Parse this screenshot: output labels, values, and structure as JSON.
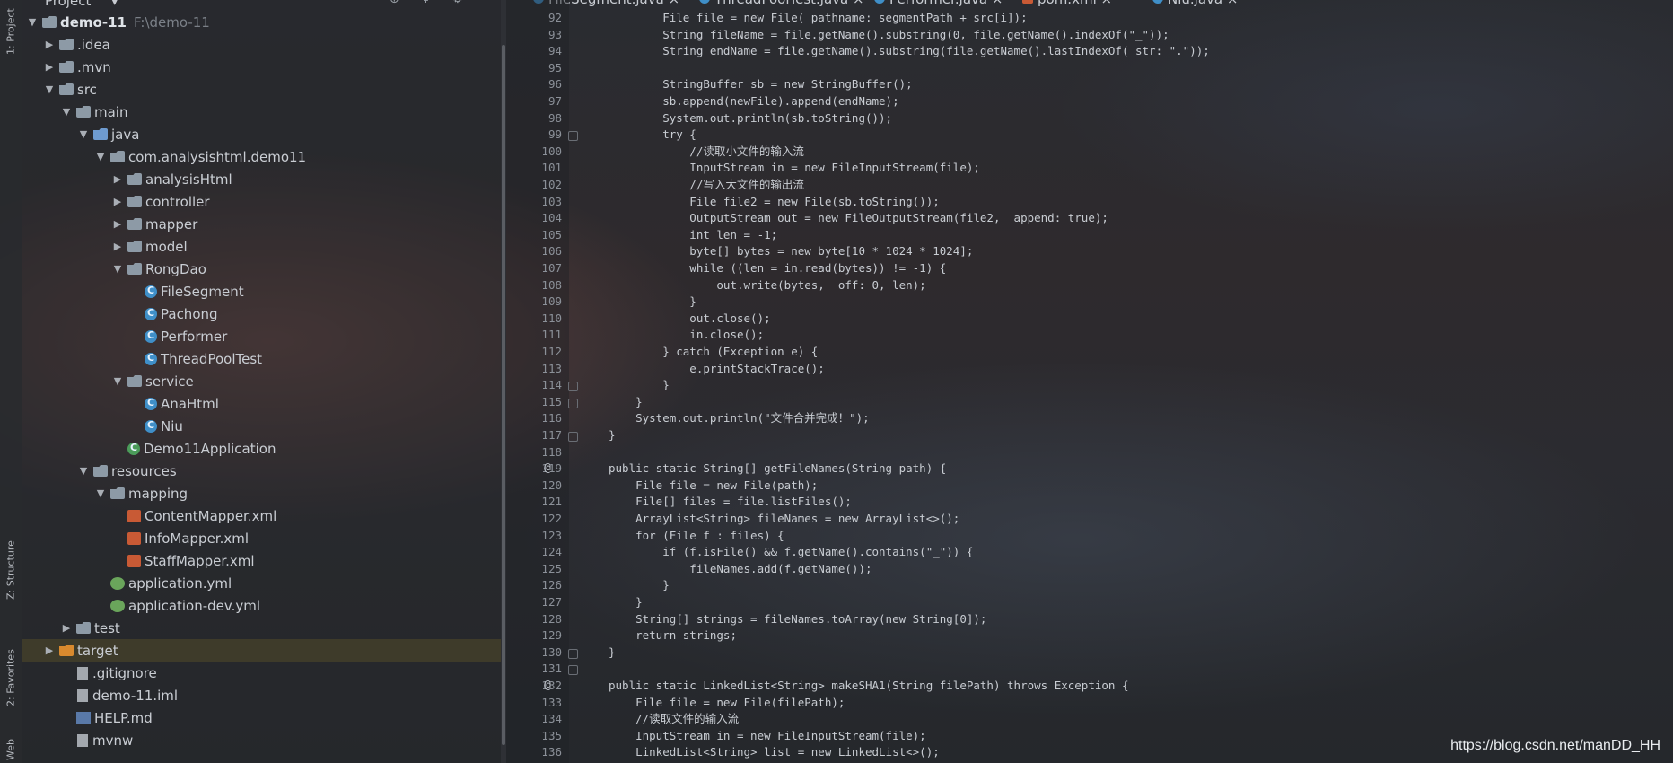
{
  "window": {
    "tabs": [
      {
        "label": "FileSegment.java"
      },
      {
        "label": "ThreadPoolTest.java"
      },
      {
        "label": "Performer.java"
      },
      {
        "label": "pom.xml"
      },
      {
        "label": "Niu.java"
      }
    ]
  },
  "toolstrip": {
    "project_tab": "1: Project",
    "structure_tab": "Z: Structure",
    "favorites_tab": "2: Favorites",
    "web_tab": "Web"
  },
  "project": {
    "title": "Project",
    "dropdown": "▾",
    "tree": [
      {
        "label": "demo-11",
        "extra": "F:\\demo-11",
        "depth": 0,
        "arrow": "▼",
        "icon": "folder",
        "bold": true
      },
      {
        "label": ".idea",
        "depth": 1,
        "arrow": "▶",
        "icon": "folder"
      },
      {
        "label": ".mvn",
        "depth": 1,
        "arrow": "▶",
        "icon": "folder"
      },
      {
        "label": "src",
        "depth": 1,
        "arrow": "▼",
        "icon": "folder"
      },
      {
        "label": "main",
        "depth": 2,
        "arrow": "▼",
        "icon": "folder"
      },
      {
        "label": "java",
        "depth": 3,
        "arrow": "▼",
        "icon": "folder-blue"
      },
      {
        "label": "com.analysishtml.demo11",
        "depth": 4,
        "arrow": "▼",
        "icon": "pkg"
      },
      {
        "label": "analysisHtml",
        "depth": 5,
        "arrow": "▶",
        "icon": "pkg"
      },
      {
        "label": "controller",
        "depth": 5,
        "arrow": "▶",
        "icon": "pkg"
      },
      {
        "label": "mapper",
        "depth": 5,
        "arrow": "▶",
        "icon": "pkg"
      },
      {
        "label": "model",
        "depth": 5,
        "arrow": "▶",
        "icon": "pkg"
      },
      {
        "label": "RongDao",
        "depth": 5,
        "arrow": "▼",
        "icon": "pkg"
      },
      {
        "label": "FileSegment",
        "depth": 6,
        "arrow": "",
        "icon": "java"
      },
      {
        "label": "Pachong",
        "depth": 6,
        "arrow": "",
        "icon": "java"
      },
      {
        "label": "Performer",
        "depth": 6,
        "arrow": "",
        "icon": "java"
      },
      {
        "label": "ThreadPoolTest",
        "depth": 6,
        "arrow": "",
        "icon": "java"
      },
      {
        "label": "service",
        "depth": 5,
        "arrow": "▼",
        "icon": "pkg"
      },
      {
        "label": "AnaHtml",
        "depth": 6,
        "arrow": "",
        "icon": "java"
      },
      {
        "label": "Niu",
        "depth": 6,
        "arrow": "",
        "icon": "java"
      },
      {
        "label": "Demo11Application",
        "depth": 5,
        "arrow": "",
        "icon": "spring"
      },
      {
        "label": "resources",
        "depth": 3,
        "arrow": "▼",
        "icon": "pkg"
      },
      {
        "label": "mapping",
        "depth": 4,
        "arrow": "▼",
        "icon": "pkg"
      },
      {
        "label": "ContentMapper.xml",
        "depth": 5,
        "arrow": "",
        "icon": "xml"
      },
      {
        "label": "InfoMapper.xml",
        "depth": 5,
        "arrow": "",
        "icon": "xml"
      },
      {
        "label": "StaffMapper.xml",
        "depth": 5,
        "arrow": "",
        "icon": "xml"
      },
      {
        "label": "application.yml",
        "depth": 4,
        "arrow": "",
        "icon": "yml"
      },
      {
        "label": "application-dev.yml",
        "depth": 4,
        "arrow": "",
        "icon": "yml"
      },
      {
        "label": "test",
        "depth": 2,
        "arrow": "▶",
        "icon": "folder"
      },
      {
        "label": "target",
        "depth": 1,
        "arrow": "▶",
        "icon": "folder-orange",
        "selected": true
      },
      {
        "label": ".gitignore",
        "depth": 2,
        "arrow": "",
        "icon": "file"
      },
      {
        "label": "demo-11.iml",
        "depth": 2,
        "arrow": "",
        "icon": "file"
      },
      {
        "label": "HELP.md",
        "depth": 2,
        "arrow": "",
        "icon": "md"
      },
      {
        "label": "mvnw",
        "depth": 2,
        "arrow": "",
        "icon": "file"
      }
    ]
  },
  "editor": {
    "lines": [
      {
        "n": "92",
        "t": "        File file = new File( pathname: segmentPath + src[i]);"
      },
      {
        "n": "93",
        "t": "        String fileName = file.getName().substring(0, file.getName().indexOf(\"_\"));"
      },
      {
        "n": "94",
        "t": "        String endName = file.getName().substring(file.getName().lastIndexOf( str: \".\"));"
      },
      {
        "n": "95",
        "t": ""
      },
      {
        "n": "96",
        "t": "        StringBuffer sb = new StringBuffer();"
      },
      {
        "n": "97",
        "t": "        sb.append(newFile).append(endName);"
      },
      {
        "n": "98",
        "t": "        System.out.println(sb.toString());"
      },
      {
        "n": "99",
        "t": "        try {"
      },
      {
        "n": "100",
        "t": "            //读取小文件的输入流"
      },
      {
        "n": "101",
        "t": "            InputStream in = new FileInputStream(file);"
      },
      {
        "n": "102",
        "t": "            //写入大文件的输出流"
      },
      {
        "n": "103",
        "t": "            File file2 = new File(sb.toString());"
      },
      {
        "n": "104",
        "t": "            OutputStream out = new FileOutputStream(file2,  append: true);"
      },
      {
        "n": "105",
        "t": "            int len = -1;"
      },
      {
        "n": "106",
        "t": "            byte[] bytes = new byte[10 * 1024 * 1024];"
      },
      {
        "n": "107",
        "t": "            while ((len = in.read(bytes)) != -1) {"
      },
      {
        "n": "108",
        "t": "                out.write(bytes,  off: 0, len);"
      },
      {
        "n": "109",
        "t": "            }"
      },
      {
        "n": "110",
        "t": "            out.close();"
      },
      {
        "n": "111",
        "t": "            in.close();"
      },
      {
        "n": "112",
        "t": "        } catch (Exception e) {"
      },
      {
        "n": "113",
        "t": "            e.printStackTrace();"
      },
      {
        "n": "114",
        "t": "        }"
      },
      {
        "n": "115",
        "t": "    }"
      },
      {
        "n": "116",
        "t": "    System.out.println(\"文件合并完成！\");"
      },
      {
        "n": "117",
        "t": "}"
      },
      {
        "n": "118",
        "t": ""
      },
      {
        "n": "119",
        "t": "public static String[] getFileNames(String path) {",
        "mark": "@"
      },
      {
        "n": "120",
        "t": "    File file = new File(path);"
      },
      {
        "n": "121",
        "t": "    File[] files = file.listFiles();"
      },
      {
        "n": "122",
        "t": "    ArrayList<String> fileNames = new ArrayList<>();"
      },
      {
        "n": "123",
        "t": "    for (File f : files) {"
      },
      {
        "n": "124",
        "t": "        if (f.isFile() && f.getName().contains(\"_\")) {"
      },
      {
        "n": "125",
        "t": "            fileNames.add(f.getName());"
      },
      {
        "n": "126",
        "t": "        }"
      },
      {
        "n": "127",
        "t": "    }"
      },
      {
        "n": "128",
        "t": "    String[] strings = fileNames.toArray(new String[0]);"
      },
      {
        "n": "129",
        "t": "    return strings;"
      },
      {
        "n": "130",
        "t": "}"
      },
      {
        "n": "131",
        "t": ""
      },
      {
        "n": "132",
        "t": "public static LinkedList<String> makeSHA1(String filePath) throws Exception {",
        "mark": "@"
      },
      {
        "n": "133",
        "t": "    File file = new File(filePath);"
      },
      {
        "n": "134",
        "t": "    //读取文件的输入流"
      },
      {
        "n": "135",
        "t": "    InputStream in = new FileInputStream(file);"
      },
      {
        "n": "136",
        "t": "    LinkedList<String> list = new LinkedList<>();"
      }
    ]
  },
  "watermark": "https://blog.csdn.net/manDD_HH"
}
